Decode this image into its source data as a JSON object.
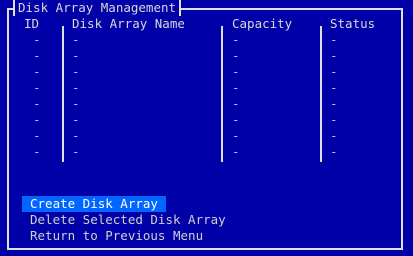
{
  "panel": {
    "title": "Disk Array Management"
  },
  "columns": [
    "ID",
    "Disk Array Name",
    "Capacity",
    "Status"
  ],
  "rows": [
    [
      "-",
      "-",
      "-",
      "-"
    ],
    [
      "-",
      "-",
      "-",
      "-"
    ],
    [
      "-",
      "-",
      "-",
      "-"
    ],
    [
      "-",
      "-",
      "-",
      "-"
    ],
    [
      "-",
      "-",
      "-",
      "-"
    ],
    [
      "-",
      "-",
      "-",
      "-"
    ],
    [
      "-",
      "-",
      "-",
      "-"
    ],
    [
      "-",
      "-",
      "-",
      "-"
    ]
  ],
  "menu": {
    "items": [
      "Create Disk Array",
      "Delete Selected Disk Array",
      "Return to Previous Menu"
    ],
    "selected_index": 0
  },
  "colors": {
    "background": "#0000a8",
    "highlight": "#0066ff"
  }
}
